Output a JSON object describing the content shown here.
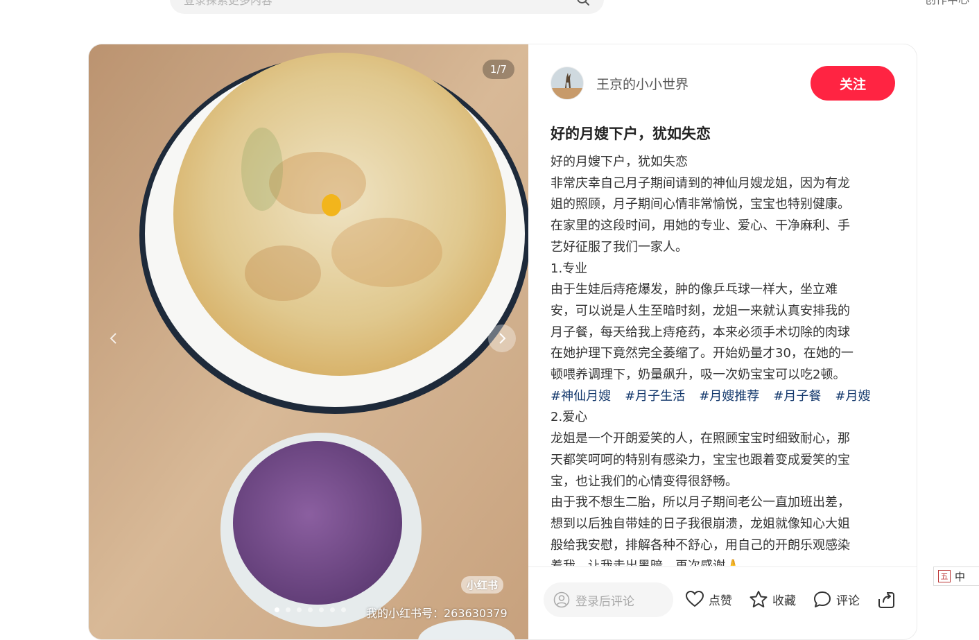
{
  "header": {
    "search_placeholder": "登录探索更多内容",
    "right_text": "创作中心"
  },
  "media": {
    "counter": "1/7",
    "watermark_logo": "小红书",
    "watermark_id": "我的小红书号：263630379",
    "dot_count": 7,
    "active_dot": 0
  },
  "author": {
    "name": "王京的小小世界",
    "follow_label": "关注"
  },
  "note": {
    "title": "好的月嫂下户，犹如失恋",
    "lines": [
      "好的月嫂下户，犹如失恋",
      "非常庆幸自己月子期间请到的神仙月嫂龙姐，因为有龙",
      "姐的照顾，月子期间心情非常愉悦，宝宝也特别健康。",
      "在家里的这段时间，用她的专业、爱心、干净麻利、手",
      "艺好征服了我们一家人。",
      "1.专业",
      "由于生娃后痔疮爆发，肿的像乒乓球一样大，坐立难",
      "安，可以说是人生至暗时刻，龙姐一来就认真安排我的",
      "月子餐，每天给我上痔疮药，本来必须手术切除的肉球",
      "在她护理下竟然完全萎缩了。开始奶量才30，在她的一",
      "顿喂养调理下，奶量飙升，吸一次奶宝宝可以吃2顿。"
    ],
    "tags": [
      "#神仙月嫂",
      "#月子生活",
      "#月嫂推荐",
      "#月子餐",
      "#月嫂"
    ],
    "lines2": [
      "2.爱心",
      "龙姐是一个开朗爱笑的人，在照顾宝宝时细致耐心，那",
      "天都笑呵呵的特别有感染力，宝宝也跟着变成爱笑的宝",
      "宝，也让我们的心情变得很舒畅。",
      "由于我不想生二胎，所以月子期间老公一直加班出差，",
      "想到以后独自带娃的日子我很崩溃，龙姐就像知心大姐",
      "般给我安慰，排解各种不舒心，用自己的开朗乐观感染",
      "着我，让我走出黑暗，再次感谢🙏"
    ]
  },
  "footer": {
    "comment_placeholder": "登录后评论",
    "like_label": "点赞",
    "collect_label": "收藏",
    "comment_label": "评论"
  },
  "ime": {
    "icon_text": "五",
    "mode": "中"
  },
  "colors": {
    "accent": "#ff2442",
    "tag": "#13386c"
  }
}
